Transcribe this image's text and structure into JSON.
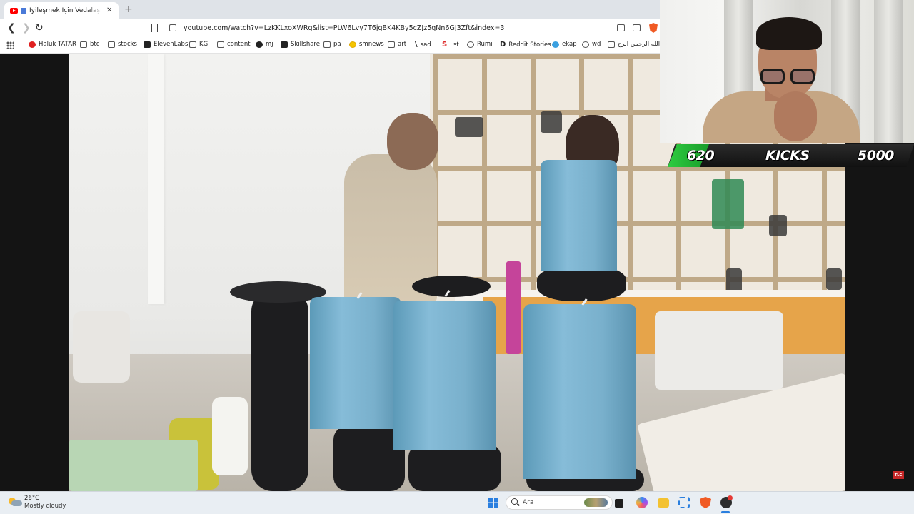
{
  "browser": {
    "tab": {
      "title": "İyileşmek İçin Vedalaşmak Şa",
      "close": "✕"
    },
    "new_tab": "+",
    "url": "youtube.com/watch?v=LzKKLxoXWRg&list=PLW6Lvy7T6jgBK4KBy5cZJz5qNn6GJ3Zft&index=3"
  },
  "bookmarks": [
    {
      "label": "Haluk TATAR",
      "icon": "youtube-red-icon"
    },
    {
      "label": "btc",
      "icon": "folder-icon"
    },
    {
      "label": "stocks",
      "icon": "folder-icon"
    },
    {
      "label": "ElevenLabs",
      "icon": "elevenlabs-icon"
    },
    {
      "label": "KG",
      "icon": "folder-icon"
    },
    {
      "label": "content",
      "icon": "folder-icon"
    },
    {
      "label": "mj",
      "icon": "github-icon"
    },
    {
      "label": "Skillshare",
      "icon": "skillshare-icon"
    },
    {
      "label": "pa",
      "icon": "folder-icon"
    },
    {
      "label": "smnews",
      "icon": "smiley-icon"
    },
    {
      "label": "art",
      "icon": "folder-icon"
    },
    {
      "label": "sad",
      "icon": "slash-icon"
    },
    {
      "label": "Lst",
      "icon": "s-red-icon"
    },
    {
      "label": "Rumi",
      "icon": "globe-icon"
    },
    {
      "label": "Reddit Stories",
      "icon": "d-icon"
    },
    {
      "label": "ekap",
      "icon": "bird-icon"
    },
    {
      "label": "wd",
      "icon": "globe-icon"
    },
    {
      "label": "الله الرحمن الرح...",
      "icon": "book-icon"
    }
  ],
  "stream_overlay": {
    "kicks_current": "620",
    "kicks_label": "KICKS",
    "kicks_goal": "5000",
    "accent_color": "#2ecc40"
  },
  "video": {
    "watermark": "TLC"
  },
  "taskbar": {
    "weather_temp": "26°C",
    "weather_desc": "Mostly cloudy",
    "search_label": "Ara"
  }
}
